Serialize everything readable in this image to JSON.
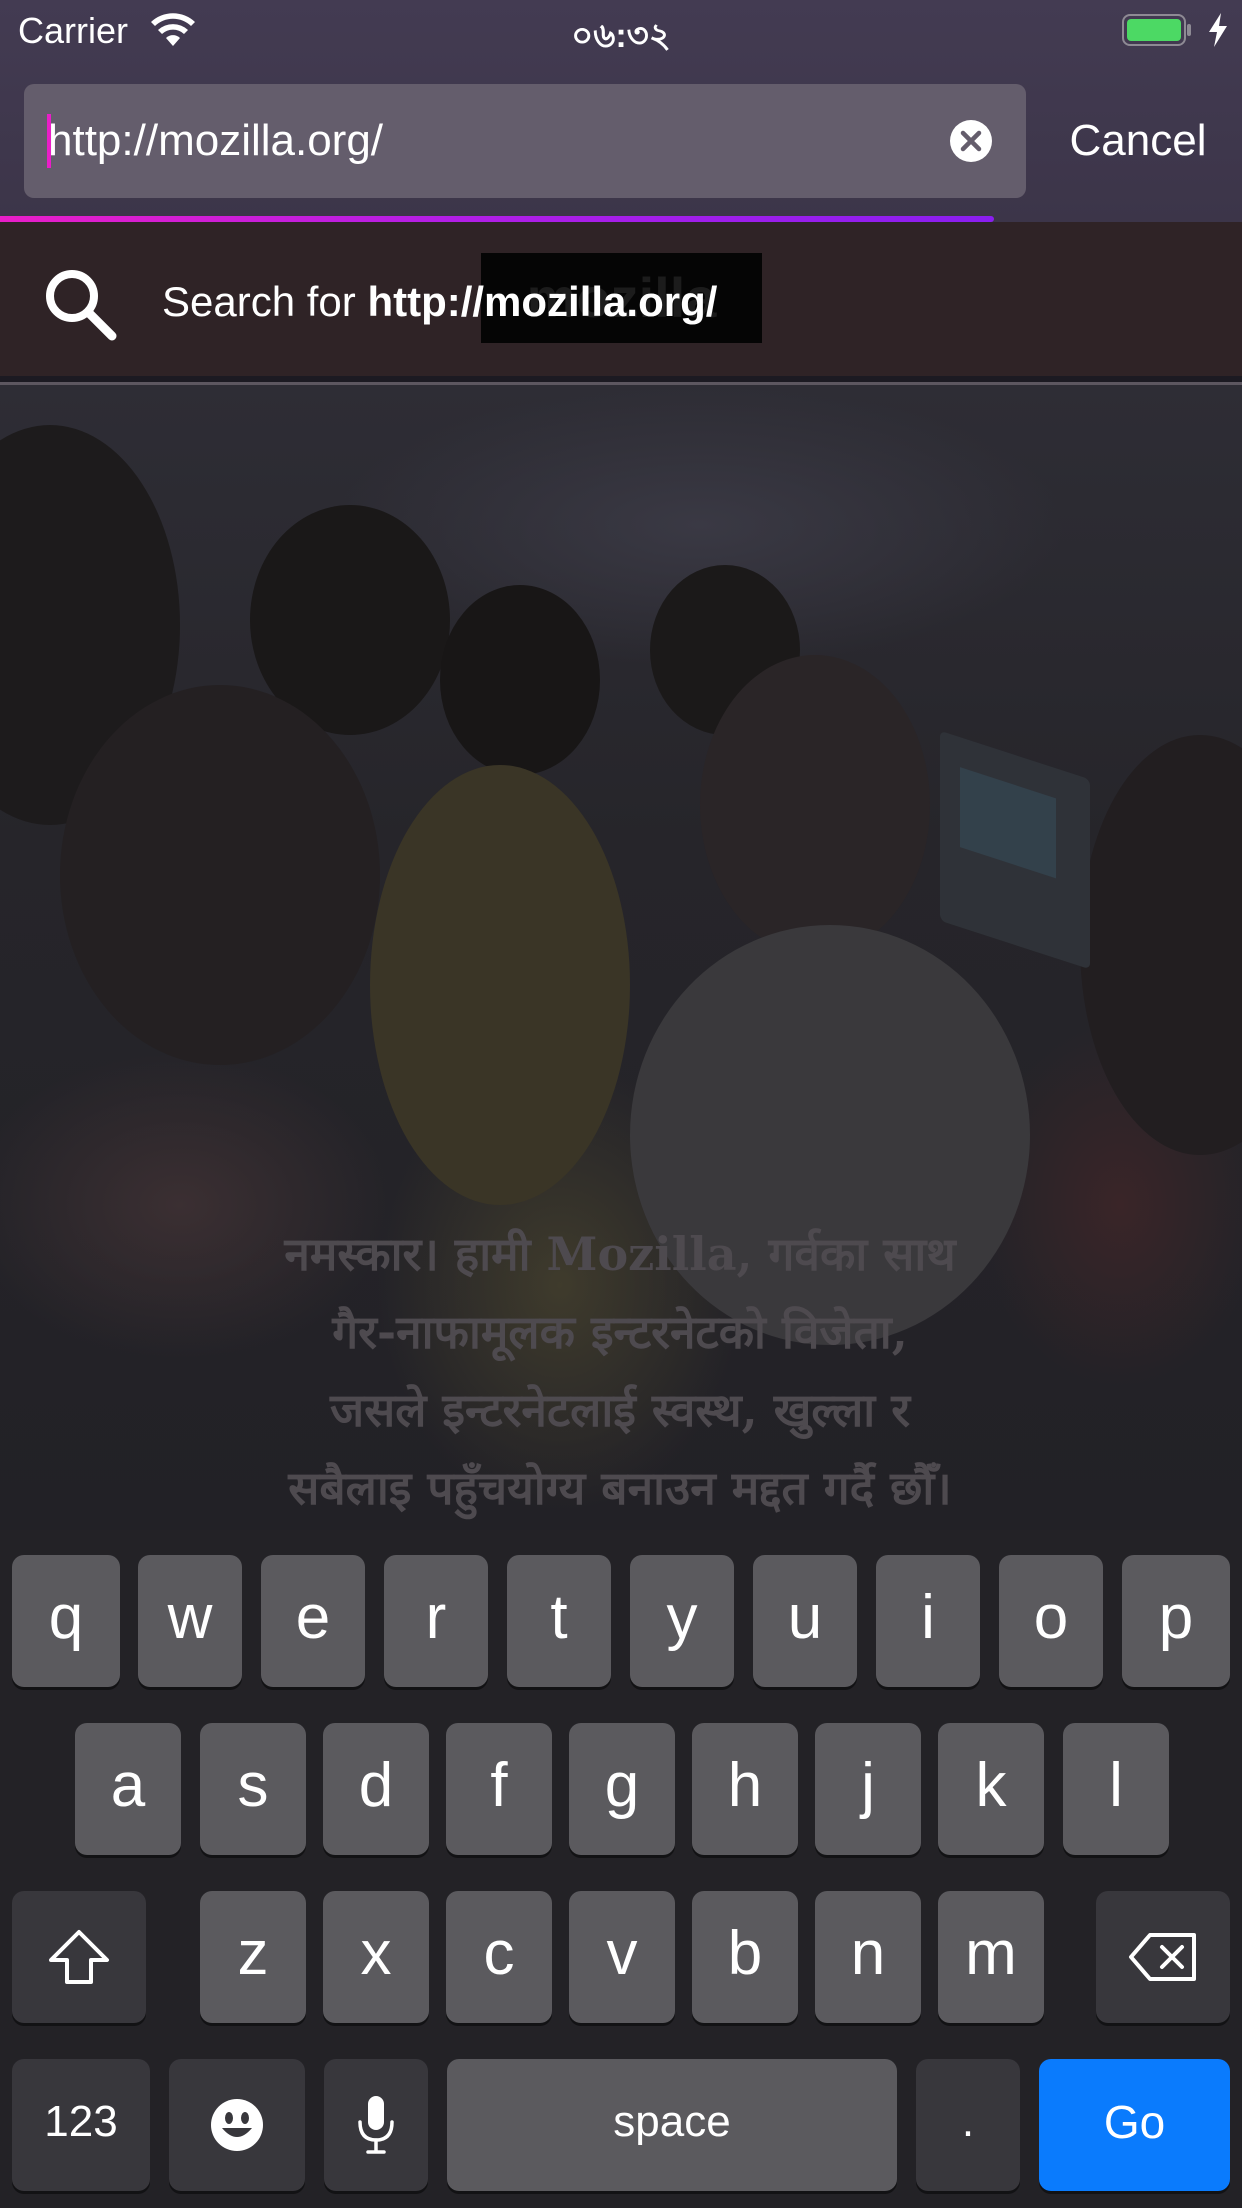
{
  "status_bar": {
    "carrier": "Carrier",
    "time": "০৬:৩২",
    "battery_color": "#4cd964"
  },
  "address_bar": {
    "url_value": "http://mozilla.org/",
    "cancel_label": "Cancel",
    "accent_color": "#e91ec8",
    "load_progress": 0.8
  },
  "suggestion": {
    "prefix": "Search for ",
    "query": "http://mozilla.org/"
  },
  "page_content": {
    "tagline_lines": [
      "नमस्कार। हामी Mozilla, गर्वका साथ",
      "गैर-नाफामूलक इन्टरनेटको विजेता,",
      "जसले इन्टरनेटलाई स्वस्थ, खुल्ला र",
      "सबैलाइ पहुँचयोग्य बनाउन मद्दत गर्दै छौँ।"
    ]
  },
  "keyboard": {
    "row1": [
      "q",
      "w",
      "e",
      "r",
      "t",
      "y",
      "u",
      "i",
      "o",
      "p"
    ],
    "row2": [
      "a",
      "s",
      "d",
      "f",
      "g",
      "h",
      "j",
      "k",
      "l"
    ],
    "row3": [
      "z",
      "x",
      "c",
      "v",
      "b",
      "n",
      "m"
    ],
    "numbers_label": "123",
    "space_label": "space",
    "period_label": ".",
    "go_label": "Go",
    "go_color": "#0a7bfd"
  }
}
